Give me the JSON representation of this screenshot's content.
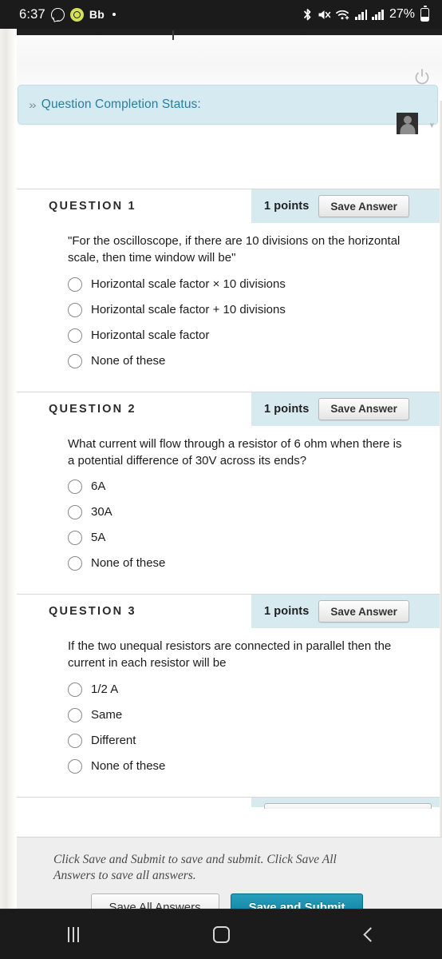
{
  "status_bar": {
    "clock": "6:37",
    "app_label": "Bb",
    "battery_percent": "27%",
    "icons": [
      "whatsapp-outline-icon",
      "whatsapp-filled-icon",
      "notification-dot-icon",
      "bluetooth-icon",
      "mute-icon",
      "wifi-icon",
      "signal-bars-icon",
      "signal-bars-2-icon",
      "battery-icon"
    ]
  },
  "page": {
    "status_callout": {
      "label": "Question Completion Status:",
      "chevron": "»",
      "background_color": "#d5eaf1",
      "text_color": "#2a7f9e"
    },
    "cut_text": ""
  },
  "questions": [
    {
      "title": "QUESTION 1",
      "points": "1 points",
      "save_label": "Save Answer",
      "text": "\"For the oscilloscope, if there are 10 divisions on the horizontal scale, then time window will be\"",
      "options": [
        "Horizontal scale factor × 10 divisions",
        "Horizontal scale factor + 10 divisions",
        "Horizontal scale factor",
        "None of these"
      ]
    },
    {
      "title": "QUESTION 2",
      "points": "1 points",
      "save_label": "Save Answer",
      "text": "What current will flow through a resistor of 6 ohm when there is a potential difference of 30V across its ends?",
      "options": [
        "6A",
        "30A",
        "5A",
        "None of these"
      ]
    },
    {
      "title": "QUESTION 3",
      "points": "1 points",
      "save_label": "Save Answer",
      "text": "If the two unequal resistors are connected in parallel then the current in each resistor will be",
      "options": [
        "1/2 A",
        "Same",
        "Different",
        "None of these"
      ]
    }
  ],
  "footer": {
    "note": "Click Save and Submit to save and submit. Click Save All Answers to save all answers.",
    "save_all_label": "Save All Answers",
    "submit_label": "Save and Submit",
    "submit_color": "#1b8fae"
  },
  "nav_bar": {
    "recent_label": "recent-apps",
    "home_label": "home",
    "back_label": "back"
  }
}
